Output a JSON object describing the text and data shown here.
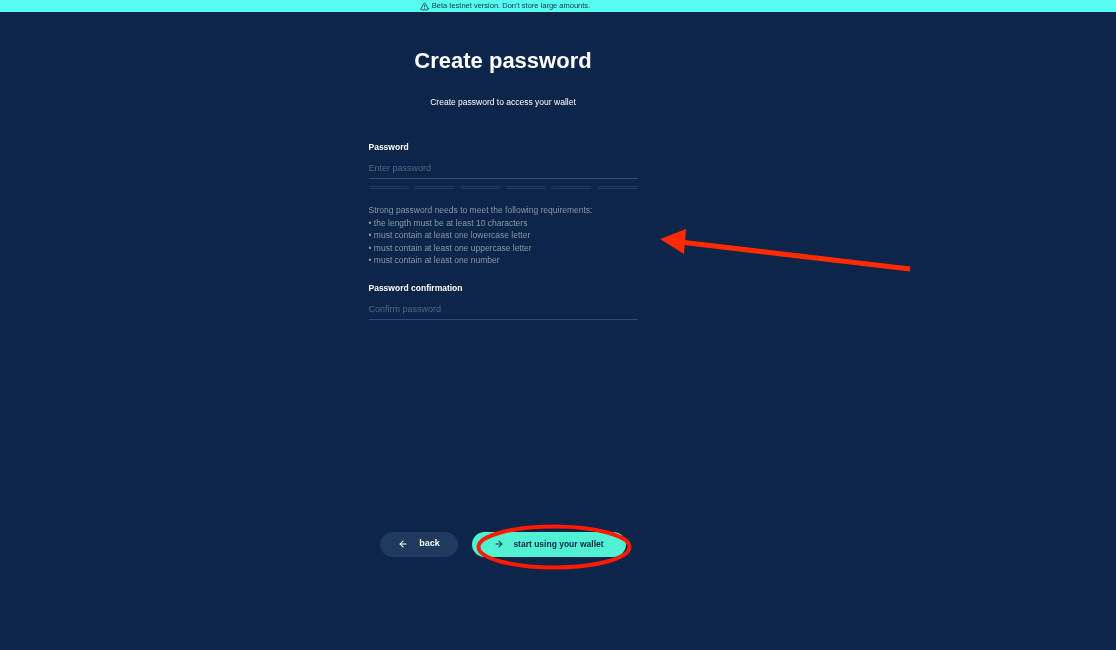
{
  "banner": {
    "text": "Beta testnet version. Don’t store large amounts."
  },
  "title": "Create password",
  "subtitle": "Create password to access your wallet",
  "password": {
    "label": "Password",
    "placeholder": "Enter password"
  },
  "requirements": {
    "intro": "Strong password needs to meet the following requirements:",
    "items": [
      "• the length must be at least 10 characters",
      "• must contain at least one lowercase letter",
      "• must contain at least one uppercase letter",
      "• must contain at least one number"
    ],
    "annotation": {
      "kind": "arrow"
    }
  },
  "confirmation": {
    "label": "Password confirmation",
    "placeholder": "Confirm password"
  },
  "buttons": [
    {
      "label": "back",
      "kind": "back"
    },
    {
      "label": "start using your wallet",
      "kind": "primary",
      "annotation": {
        "kind": "ellipse"
      }
    }
  ]
}
